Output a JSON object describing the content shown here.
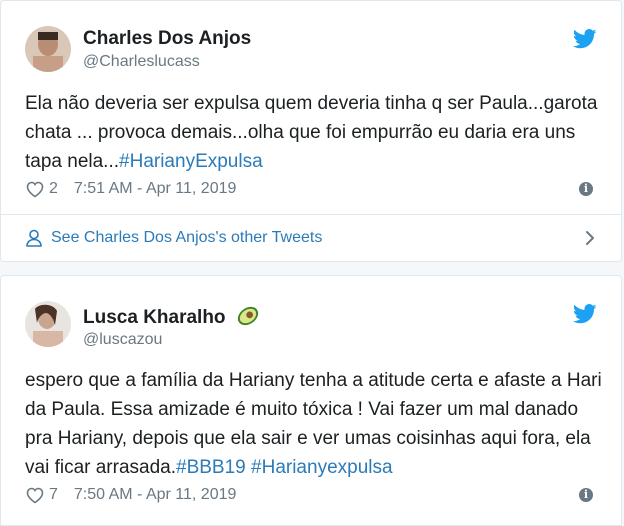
{
  "tweets": [
    {
      "author_name": "Charles Dos Anjos",
      "author_handle": "@Charleslucass",
      "text": "Ela não deveria ser expulsa quem deveria tinha q ser Paula...garota chata ... provoca demais...olha que foi empurrão eu daria era uns tapa nela...",
      "hashtags": [
        "#HarianyExpulsa"
      ],
      "likes": "2",
      "timestamp": "7:51 AM - Apr 11, 2019",
      "other_tweets_link": "See Charles Dos Anjos's other Tweets"
    },
    {
      "author_name": "Lusca Kharalho",
      "author_emoji": "avocado-icon",
      "author_handle": "@luscazou",
      "text": "espero que a família da Hariany tenha a atitude certa e afaste a Hari da Paula. Essa amizade é muito tóxica ! Vai fazer um mal danado pra Hariany, depois que ela sair e ver umas coisinhas aqui fora, ela vai ficar arrasada.",
      "hashtags": [
        "#BBB19",
        "#Harianyexpulsa"
      ],
      "likes": "7",
      "timestamp": "7:50 AM - Apr 11, 2019"
    }
  ],
  "colors": {
    "link": "#2b7bb9",
    "muted": "#697882",
    "text": "#1c2022",
    "twitter_blue": "#1da1f2"
  }
}
